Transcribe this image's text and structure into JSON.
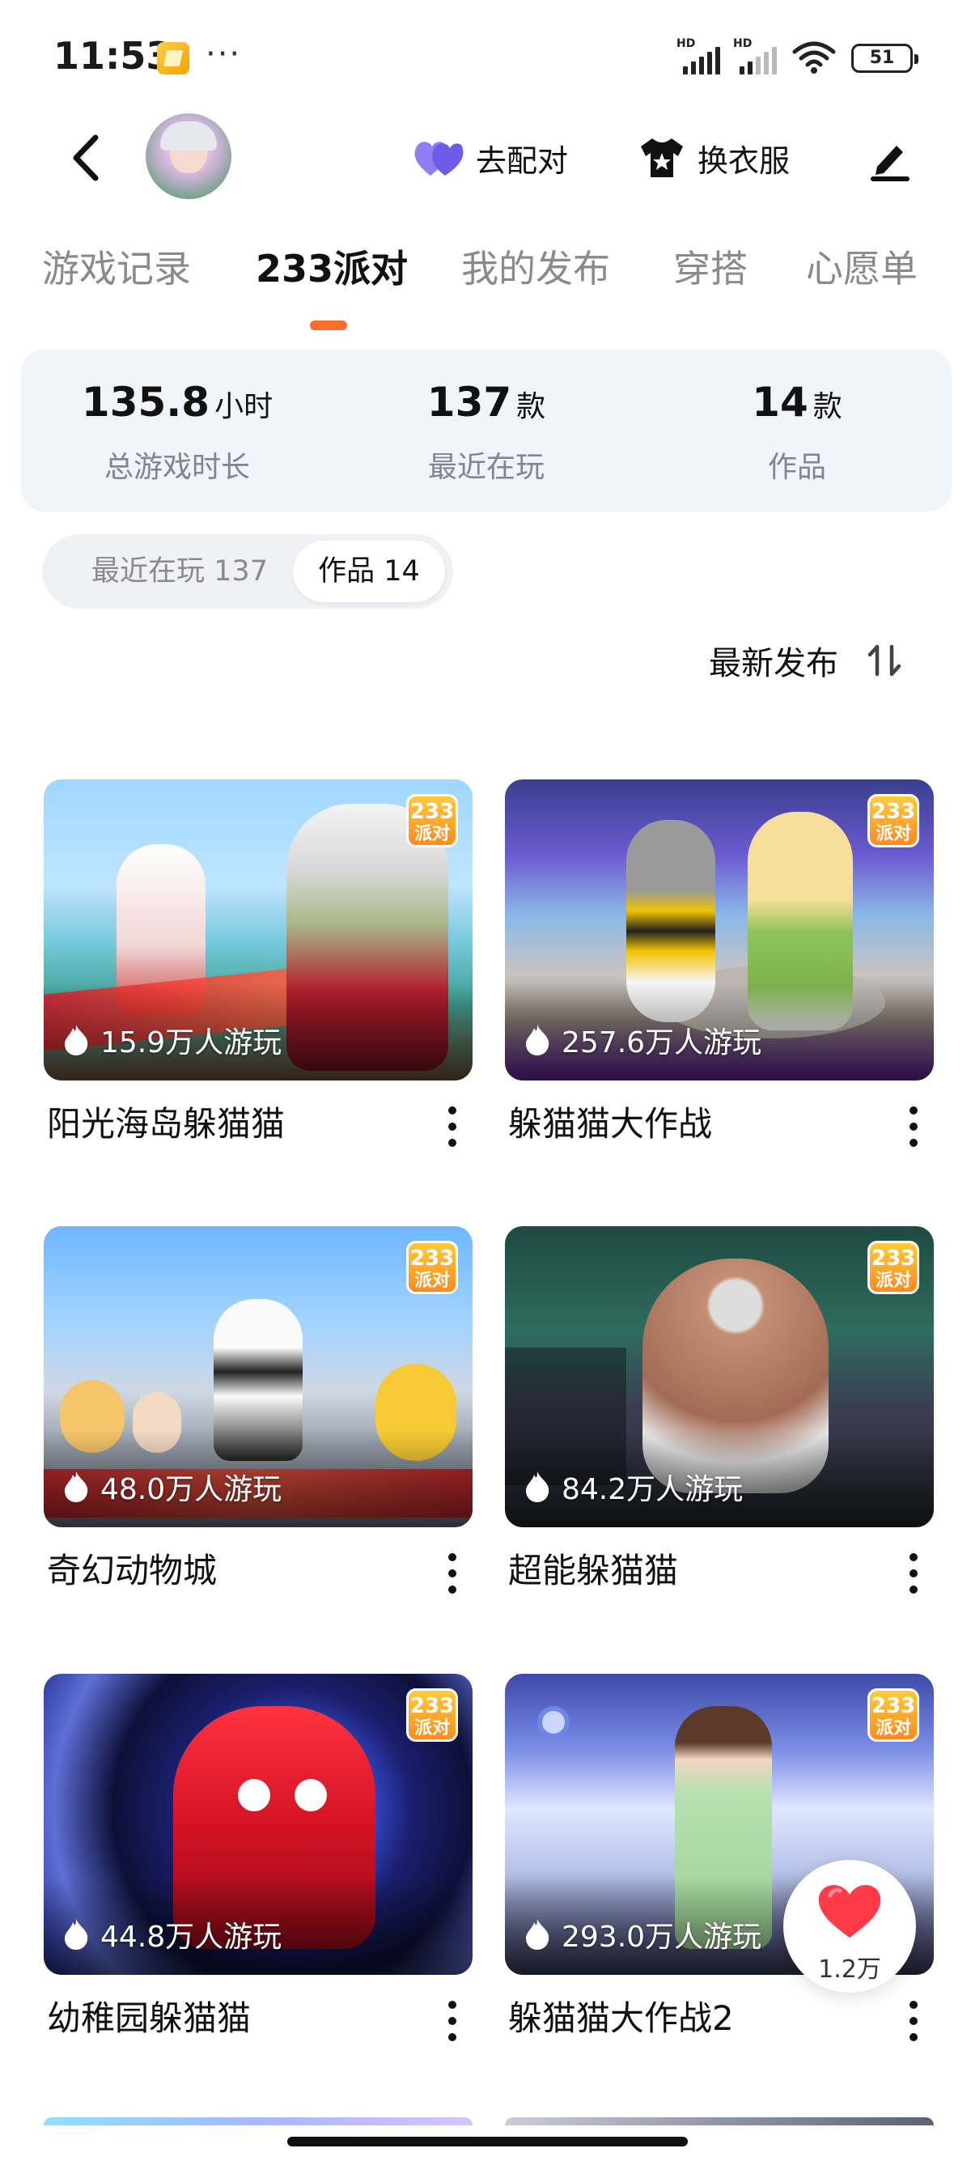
{
  "status_bar": {
    "time": "11:53",
    "dots": "···",
    "battery": "51"
  },
  "header": {
    "party_label": "去配对",
    "dress_label": "换衣服"
  },
  "tabs": [
    {
      "label": "游戏记录"
    },
    {
      "label": "233派对"
    },
    {
      "label": "我的发布"
    },
    {
      "label": "穿搭"
    },
    {
      "label": "心愿单"
    }
  ],
  "stats": [
    {
      "value": "135.8",
      "unit": "小时",
      "label": "总游戏时长"
    },
    {
      "value": "137",
      "unit": "款",
      "label": "最近在玩"
    },
    {
      "value": "14",
      "unit": "款",
      "label": "作品"
    }
  ],
  "filters": {
    "recent": "最近在玩 137",
    "works": "作品 14"
  },
  "sort": {
    "label": "最新发布"
  },
  "badge": {
    "line1": "233",
    "line2": "派对"
  },
  "games": [
    {
      "title": "阳光海岛躲猫猫",
      "plays": "15.9万人游玩"
    },
    {
      "title": "躲猫猫大作战",
      "plays": "257.6万人游玩"
    },
    {
      "title": "奇幻动物城",
      "plays": "48.0万人游玩"
    },
    {
      "title": "超能躲猫猫",
      "plays": "84.2万人游玩"
    },
    {
      "title": "幼稚园躲猫猫",
      "plays": "44.8万人游玩"
    },
    {
      "title": "躲猫猫大作战2",
      "plays": "293.0万人游玩"
    }
  ],
  "like": {
    "count": "1.2万"
  },
  "colors": {
    "accent": "#ff6b2c",
    "card_bg": "#f0f4fb",
    "heart": "#ff3b4a"
  }
}
